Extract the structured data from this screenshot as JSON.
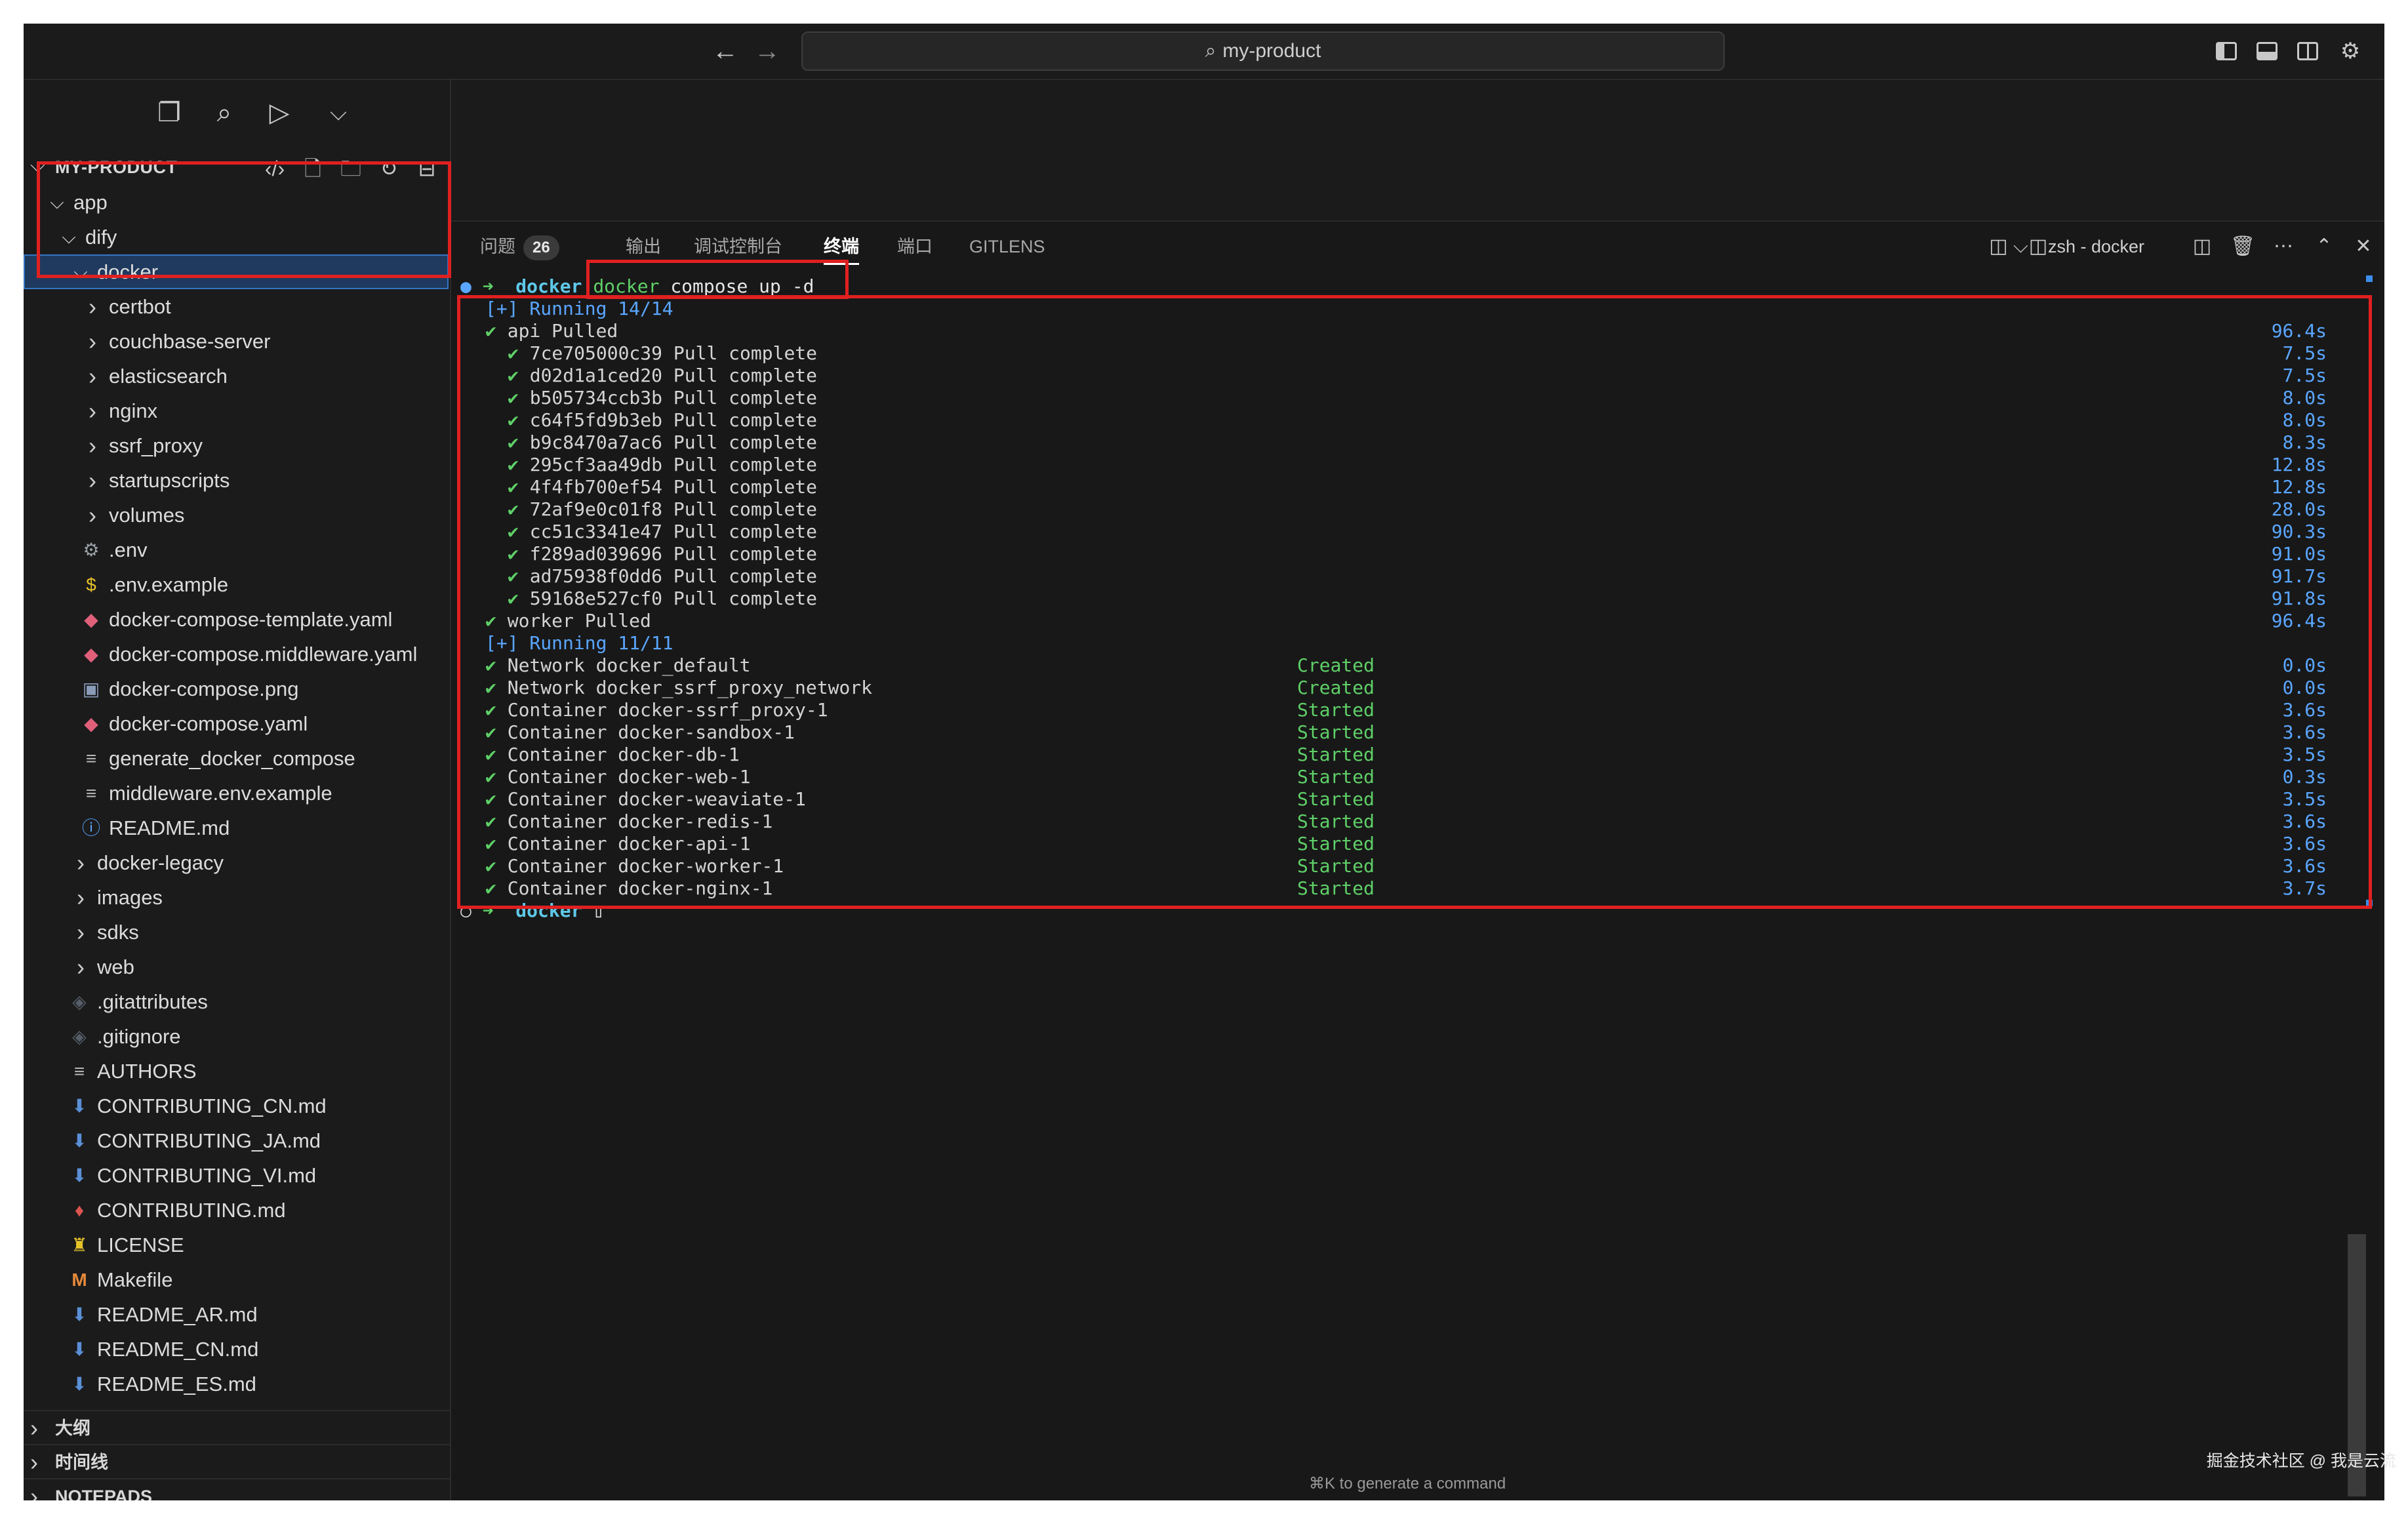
{
  "titlebar": {
    "search_text": "my-product",
    "back_icon": "←",
    "forward_icon": "→"
  },
  "explorer": {
    "title": "MY-PRODUCT"
  },
  "tree": [
    {
      "label": "app",
      "kind": "folder-open",
      "depth": 0
    },
    {
      "label": "dify",
      "kind": "folder-open",
      "depth": 1
    },
    {
      "label": "docker",
      "kind": "folder-open",
      "depth": 2,
      "selected": true
    },
    {
      "label": "certbot",
      "kind": "folder",
      "depth": 3
    },
    {
      "label": "couchbase-server",
      "kind": "folder",
      "depth": 3
    },
    {
      "label": "elasticsearch",
      "kind": "folder",
      "depth": 3
    },
    {
      "label": "nginx",
      "kind": "folder",
      "depth": 3
    },
    {
      "label": "ssrf_proxy",
      "kind": "folder",
      "depth": 3
    },
    {
      "label": "startupscripts",
      "kind": "folder",
      "depth": 3
    },
    {
      "label": "volumes",
      "kind": "folder",
      "depth": 3
    },
    {
      "label": ".env",
      "kind": "gear",
      "depth": 3
    },
    {
      "label": ".env.example",
      "kind": "dollar",
      "depth": 3
    },
    {
      "label": "docker-compose-template.yaml",
      "kind": "whale",
      "depth": 3
    },
    {
      "label": "docker-compose.middleware.yaml",
      "kind": "whale",
      "depth": 3
    },
    {
      "label": "docker-compose.png",
      "kind": "image",
      "depth": 3
    },
    {
      "label": "docker-compose.yaml",
      "kind": "whale",
      "depth": 3
    },
    {
      "label": "generate_docker_compose",
      "kind": "lines",
      "depth": 3
    },
    {
      "label": "middleware.env.example",
      "kind": "lines",
      "depth": 3
    },
    {
      "label": "README.md",
      "kind": "info",
      "depth": 3
    },
    {
      "label": "docker-legacy",
      "kind": "folder",
      "depth": 2
    },
    {
      "label": "images",
      "kind": "folder",
      "depth": 2
    },
    {
      "label": "sdks",
      "kind": "folder",
      "depth": 2
    },
    {
      "label": "web",
      "kind": "folder",
      "depth": 2
    },
    {
      "label": ".gitattributes",
      "kind": "git",
      "depth": 2
    },
    {
      "label": ".gitignore",
      "kind": "git",
      "depth": 2
    },
    {
      "label": "AUTHORS",
      "kind": "lines",
      "depth": 2
    },
    {
      "label": "CONTRIBUTING_CN.md",
      "kind": "md",
      "depth": 2
    },
    {
      "label": "CONTRIBUTING_JA.md",
      "kind": "md",
      "depth": 2
    },
    {
      "label": "CONTRIBUTING_VI.md",
      "kind": "md",
      "depth": 2
    },
    {
      "label": "CONTRIBUTING.md",
      "kind": "ribbon",
      "depth": 2
    },
    {
      "label": "LICENSE",
      "kind": "license",
      "depth": 2
    },
    {
      "label": "Makefile",
      "kind": "makefile",
      "depth": 2
    },
    {
      "label": "README_AR.md",
      "kind": "md",
      "depth": 2
    },
    {
      "label": "README_CN.md",
      "kind": "md",
      "depth": 2
    },
    {
      "label": "README_ES.md",
      "kind": "md",
      "depth": 2
    }
  ],
  "sidebar_panels": [
    "大纲",
    "时间线",
    "NOTEPADS"
  ],
  "panel": {
    "tabs": [
      {
        "label": "问题",
        "badge": "26"
      },
      {
        "label": "输出"
      },
      {
        "label": "调试控制台"
      },
      {
        "label": "终端",
        "active": true
      },
      {
        "label": "端口"
      },
      {
        "label": "GITLENS"
      }
    ],
    "terminal_name": "zsh - docker"
  },
  "terminal": {
    "prompt_dir": "docker",
    "command_word": "docker",
    "command_rest": " compose up -d",
    "running1": "[+] Running 14/14",
    "api_pulled": {
      "text": "api Pulled",
      "dur": "96.4s"
    },
    "layers": [
      {
        "id": "7ce705000c39",
        "dur": "7.5s"
      },
      {
        "id": "d02d1a1ced20",
        "dur": "7.5s"
      },
      {
        "id": "b505734ccb3b",
        "dur": "8.0s"
      },
      {
        "id": "c64f5fd9b3eb",
        "dur": "8.0s"
      },
      {
        "id": "b9c8470a7ac6",
        "dur": "8.3s"
      },
      {
        "id": "295cf3aa49db",
        "dur": "12.8s"
      },
      {
        "id": "4f4fb700ef54",
        "dur": "12.8s"
      },
      {
        "id": "72af9e0c01f8",
        "dur": "28.0s"
      },
      {
        "id": "cc51c3341e47",
        "dur": "90.3s"
      },
      {
        "id": "f289ad039696",
        "dur": "91.0s"
      },
      {
        "id": "ad75938f0dd6",
        "dur": "91.7s"
      },
      {
        "id": "59168e527cf0",
        "dur": "91.8s"
      }
    ],
    "pull_complete": "Pull complete",
    "worker_pulled": {
      "text": "worker Pulled",
      "dur": "96.4s"
    },
    "running2": "[+] Running 11/11",
    "resources": [
      {
        "name": "Network docker_default",
        "status": "Created",
        "dur": "0.0s"
      },
      {
        "name": "Network docker_ssrf_proxy_network",
        "status": "Created",
        "dur": "0.0s"
      },
      {
        "name": "Container docker-ssrf_proxy-1",
        "status": "Started",
        "dur": "3.6s"
      },
      {
        "name": "Container docker-sandbox-1",
        "status": "Started",
        "dur": "3.6s"
      },
      {
        "name": "Container docker-db-1",
        "status": "Started",
        "dur": "3.5s"
      },
      {
        "name": "Container docker-web-1",
        "status": "Started",
        "dur": "0.3s"
      },
      {
        "name": "Container docker-weaviate-1",
        "status": "Started",
        "dur": "3.5s"
      },
      {
        "name": "Container docker-redis-1",
        "status": "Started",
        "dur": "3.6s"
      },
      {
        "name": "Container docker-api-1",
        "status": "Started",
        "dur": "3.6s"
      },
      {
        "name": "Container docker-worker-1",
        "status": "Started",
        "dur": "3.6s"
      },
      {
        "name": "Container docker-nginx-1",
        "status": "Started",
        "dur": "3.7s"
      }
    ],
    "final_prompt": "docker"
  },
  "hint": "⌘K to generate a command",
  "watermark": "掘金技术社区 @ 我是云流"
}
